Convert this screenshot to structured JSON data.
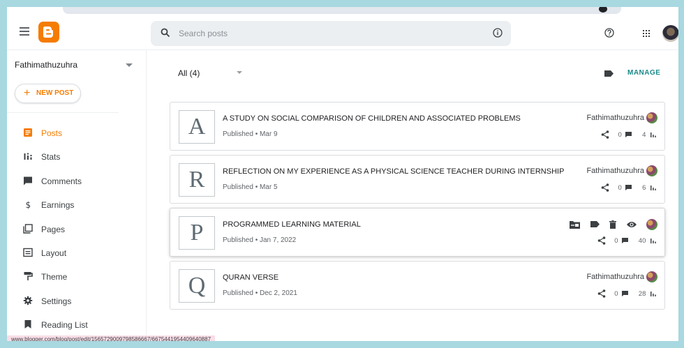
{
  "header": {
    "search_placeholder": "Search posts"
  },
  "sidebar": {
    "blog_name": "Fathimathuzuhra",
    "new_post_label": "NEW POST",
    "items": [
      {
        "label": "Posts",
        "icon": "posts-icon",
        "active": true
      },
      {
        "label": "Stats",
        "icon": "stats-icon"
      },
      {
        "label": "Comments",
        "icon": "comments-icon"
      },
      {
        "label": "Earnings",
        "icon": "earnings-icon"
      },
      {
        "label": "Pages",
        "icon": "pages-icon"
      },
      {
        "label": "Layout",
        "icon": "layout-icon"
      },
      {
        "label": "Theme",
        "icon": "theme-icon"
      },
      {
        "label": "Settings",
        "icon": "gear-icon"
      },
      {
        "label": "Reading List",
        "icon": "bookmark-icon"
      }
    ]
  },
  "main": {
    "filter_label": "All (4)",
    "manage_label": "MANAGE",
    "posts": [
      {
        "letter": "A",
        "title": "A STUDY ON SOCIAL COMPARISON OF CHILDREN AND ASSOCIATED PROBLEMS",
        "status": "Published • Mar 9",
        "author": "Fathimathuzuhra",
        "comments": "0",
        "views": "4"
      },
      {
        "letter": "R",
        "title": "REFLECTION ON MY EXPERIENCE AS A PHYSICAL SCIENCE TEACHER DURING INTERNSHIP",
        "status": "Published • Mar 5",
        "author": "Fathimathuzuhra",
        "comments": "0",
        "views": "6"
      },
      {
        "letter": "P",
        "title": "PROGRAMMED LEARNING MATERIAL",
        "status": "Published • Jan 7, 2022",
        "author": "",
        "comments": "0",
        "views": "40"
      },
      {
        "letter": "Q",
        "title": "QURAN VERSE",
        "status": "Published • Dec 2, 2021",
        "author": "Fathimathuzuhra",
        "comments": "0",
        "views": "28"
      }
    ]
  },
  "status_bar": {
    "url": "www.blogger.com/blog/post/edit/1565729009798586667/6675441954409640887"
  },
  "colors": {
    "accent": "#f57c00",
    "manage": "#1a8a8a"
  }
}
